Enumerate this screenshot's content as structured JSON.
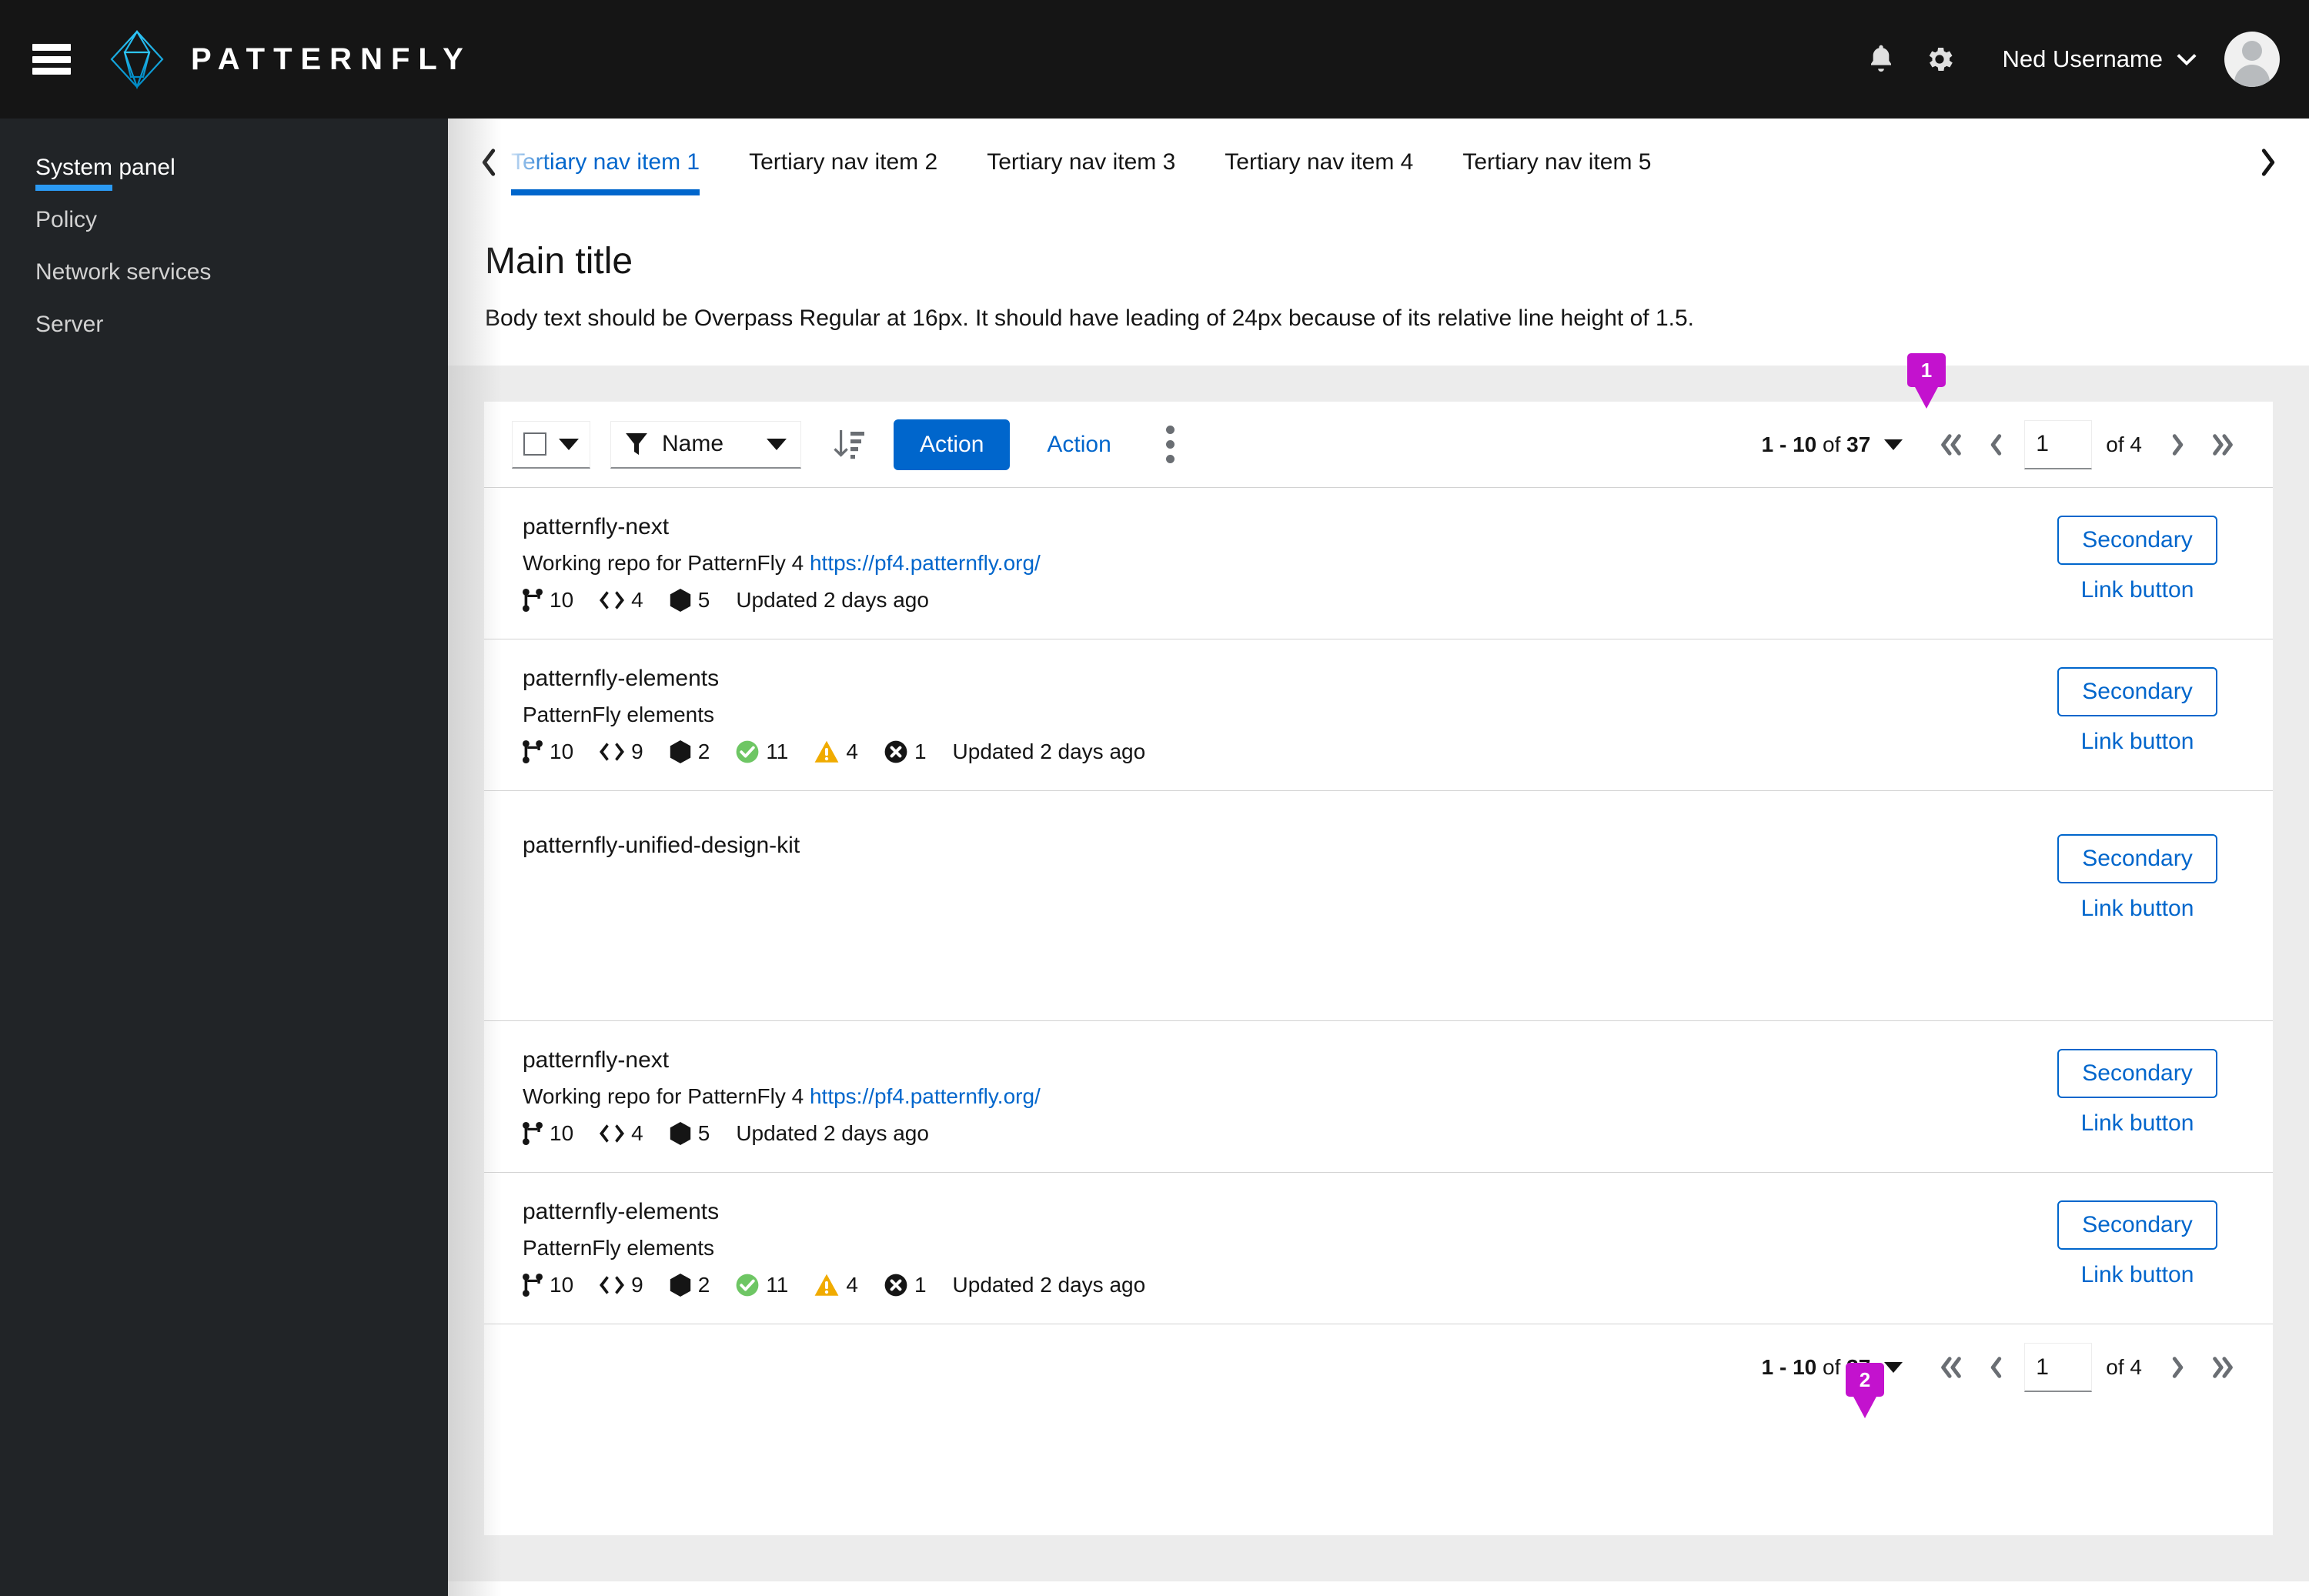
{
  "masthead": {
    "menu_icon": "hamburger-icon",
    "brand_name": "PATTERNFLY",
    "notification_icon": "bell-icon",
    "settings_icon": "gear-icon",
    "username": "Ned Username",
    "user_caret": "⌄",
    "avatar": "user-avatar"
  },
  "sidebar": {
    "items": [
      {
        "label": "System panel",
        "current": true
      },
      {
        "label": "Policy",
        "current": false
      },
      {
        "label": "Network services",
        "current": false
      },
      {
        "label": "Server",
        "current": false
      }
    ]
  },
  "tertiary_nav": {
    "scroll_left": "‹",
    "scroll_right": "›",
    "items": [
      {
        "label": "Tertiary nav item 1",
        "active": true
      },
      {
        "label": "Tertiary nav item 2",
        "active": false
      },
      {
        "label": "Tertiary nav item 3",
        "active": false
      },
      {
        "label": "Tertiary nav item 4",
        "active": false
      },
      {
        "label": "Tertiary nav item 5",
        "active": false
      }
    ]
  },
  "page": {
    "title": "Main title",
    "subtitle": "Body text should be Overpass Regular at 16px. It should have leading of 24px because of its relative line height of 1.5."
  },
  "toolbar": {
    "bulk_select_icon": "checkbox-icon",
    "filter_icon": "filter-icon",
    "filter_label": "Name",
    "sort_icon": "sort-amount-down-icon",
    "primary_action": "Action",
    "link_action": "Action",
    "kebab_icon": "kebab-vertical-icon"
  },
  "pagination": {
    "summary_range": "1 - 10",
    "summary_of": "of",
    "summary_total": "37",
    "first_icon": "angle-double-left-icon",
    "prev_icon": "angle-left-icon",
    "page_value": "1",
    "page_of_label": "of 4",
    "next_icon": "angle-right-icon",
    "last_icon": "angle-double-right-icon"
  },
  "rows": [
    {
      "title": "patternfly-next",
      "description": "Working repo for PatternFly 4 ",
      "link": "https://pf4.patternfly.org/",
      "meta": [
        {
          "icon": "code-branch-icon",
          "value": "10"
        },
        {
          "icon": "code-icon",
          "value": "4"
        },
        {
          "icon": "cube-icon",
          "value": "5"
        }
      ],
      "updated": "Updated 2 days ago",
      "secondary_label": "Secondary",
      "link_label": "Link button"
    },
    {
      "title": "patternfly-elements",
      "description": "PatternFly elements",
      "link": "",
      "meta": [
        {
          "icon": "code-branch-icon",
          "value": "10"
        },
        {
          "icon": "code-icon",
          "value": "9"
        },
        {
          "icon": "cube-icon",
          "value": "2"
        },
        {
          "icon": "check-circle-icon",
          "value": "11"
        },
        {
          "icon": "exclamation-triangle-icon",
          "value": "4"
        },
        {
          "icon": "times-circle-icon",
          "value": "1"
        }
      ],
      "updated": "Updated 2 days ago",
      "secondary_label": "Secondary",
      "link_label": "Link button"
    },
    {
      "title": "patternfly-unified-design-kit",
      "description": "",
      "link": "",
      "meta": [],
      "updated": "",
      "secondary_label": "Secondary",
      "link_label": "Link button"
    },
    {
      "title": "patternfly-next",
      "description": "Working repo for PatternFly 4 ",
      "link": "https://pf4.patternfly.org/",
      "meta": [
        {
          "icon": "code-branch-icon",
          "value": "10"
        },
        {
          "icon": "code-icon",
          "value": "4"
        },
        {
          "icon": "cube-icon",
          "value": "5"
        }
      ],
      "updated": "Updated 2 days ago",
      "secondary_label": "Secondary",
      "link_label": "Link button"
    },
    {
      "title": "patternfly-elements",
      "description": "PatternFly elements",
      "link": "",
      "meta": [
        {
          "icon": "code-branch-icon",
          "value": "10"
        },
        {
          "icon": "code-icon",
          "value": "9"
        },
        {
          "icon": "cube-icon",
          "value": "2"
        },
        {
          "icon": "check-circle-icon",
          "value": "11"
        },
        {
          "icon": "exclamation-triangle-icon",
          "value": "4"
        },
        {
          "icon": "times-circle-icon",
          "value": "1"
        }
      ],
      "updated": "Updated 2 days ago",
      "secondary_label": "Secondary",
      "link_label": "Link button"
    }
  ],
  "markers": [
    {
      "label": "1"
    },
    {
      "label": "2"
    }
  ],
  "colors": {
    "brand_dark": "#151515",
    "sidebar": "#212427",
    "accent_blue": "#0066cc",
    "active_nav_blue": "#2b9af3",
    "marker_purple": "#c312ce",
    "success_green": "#6ec664",
    "warning_orange": "#f0ab00",
    "content_bg": "#ececec"
  }
}
